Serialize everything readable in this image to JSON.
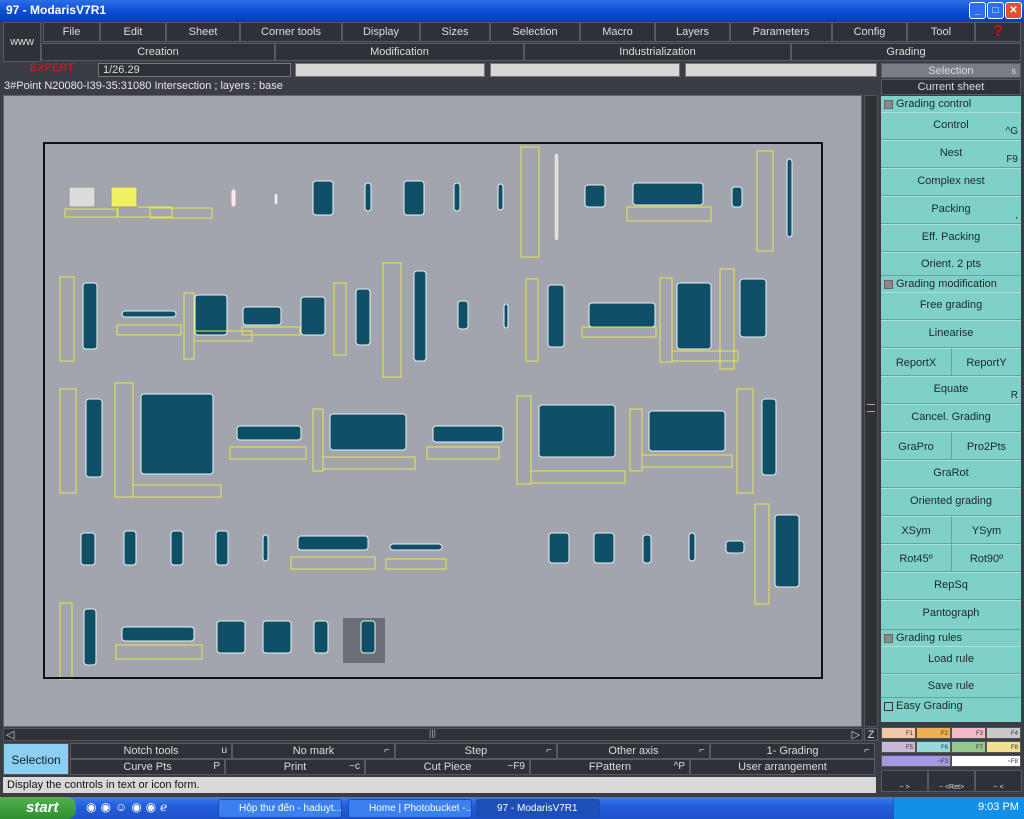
{
  "window": {
    "title": "97   - ModarisV7R1"
  },
  "menu": {
    "www": "www",
    "items": [
      "File",
      "Edit",
      "Sheet",
      "Corner tools",
      "Display",
      "Sizes",
      "Selection",
      "Macro",
      "Layers",
      "Parameters",
      "Config",
      "Tool"
    ],
    "help": "?"
  },
  "groups": [
    "Creation",
    "Modification",
    "Industrialization",
    "Grading"
  ],
  "toolbar": {
    "mode": "EXPERT",
    "scale": "1/26.29",
    "selection": "Selection",
    "selection_key": "s",
    "current_sheet": "Current sheet"
  },
  "info_line": "3#Point N20080-I39-35:31080 Intersection ;    layers :  base",
  "panel": [
    {
      "type": "check",
      "label": "Grading control"
    },
    {
      "type": "btn",
      "label": "Control",
      "key": "^G"
    },
    {
      "type": "btn",
      "label": "Nest",
      "key": "F9"
    },
    {
      "type": "btn",
      "label": "Complex nest"
    },
    {
      "type": "btn",
      "label": "Packing",
      "key": ","
    },
    {
      "type": "btn",
      "label": "Eff. Packing"
    },
    {
      "type": "btn",
      "label": "Orient. 2 pts"
    },
    {
      "type": "check",
      "label": "Grading modification"
    },
    {
      "type": "btn",
      "label": "Free grading"
    },
    {
      "type": "btn",
      "label": "Linearise"
    },
    {
      "type": "pair",
      "labels": [
        "ReportX",
        "ReportY"
      ]
    },
    {
      "type": "btn",
      "label": "Equate",
      "key": "R"
    },
    {
      "type": "btn",
      "label": "Cancel. Grading"
    },
    {
      "type": "pair",
      "labels": [
        "GraPro",
        "Pro2Pts"
      ]
    },
    {
      "type": "btn",
      "label": "GraRot"
    },
    {
      "type": "btn",
      "label": "Oriented grading"
    },
    {
      "type": "pair",
      "labels": [
        "XSym",
        "YSym"
      ]
    },
    {
      "type": "pair",
      "labels": [
        "Rot45º",
        "Rot90º"
      ]
    },
    {
      "type": "btn",
      "label": "RepSq"
    },
    {
      "type": "btn",
      "label": "Pantograph"
    },
    {
      "type": "check",
      "label": "Grading rules"
    },
    {
      "type": "btn",
      "label": "Load rule"
    },
    {
      "type": "btn",
      "label": "Save rule"
    },
    {
      "type": "check",
      "label": "Easy Grading",
      "empty": true
    }
  ],
  "fkeys": [
    {
      "label": "F1",
      "color": "#f2c8a8"
    },
    {
      "label": "F2",
      "color": "#f0b050"
    },
    {
      "label": "F3",
      "color": "#f7b8c8"
    },
    {
      "label": "F4",
      "color": "#c8c8c8"
    },
    {
      "label": "F5",
      "color": "#c8b8d8"
    },
    {
      "label": "F6",
      "color": "#98d8d8"
    },
    {
      "label": "F7",
      "color": "#98c890"
    },
    {
      "label": "F8",
      "color": "#f0e090"
    },
    {
      "label": "~F3",
      "color": "#a898e0"
    },
    {
      "label": "~F8",
      "color": "#ffffff"
    }
  ],
  "nav_keys": [
    "~  >",
    "~ <Ret>",
    "~  <"
  ],
  "bottom": {
    "selection": "Selection",
    "row1": [
      {
        "label": "Notch tools",
        "key": "u"
      },
      {
        "label": "No mark",
        "key": "⌐"
      },
      {
        "label": "Step",
        "key": "⌐"
      },
      {
        "label": "Other axis",
        "key": "⌐"
      },
      {
        "label": "1- Grading",
        "key": "⌐"
      }
    ],
    "row2": [
      {
        "label": "Curve Pts",
        "key": "P"
      },
      {
        "label": "Print",
        "key": "~c"
      },
      {
        "label": "Cut Piece",
        "key": "~F9"
      },
      {
        "label": "FPattern",
        "key": "^P"
      },
      {
        "label": "User arrangement",
        "key": ""
      }
    ],
    "zoom_key": "Z"
  },
  "status": "Display the controls in text or icon form.",
  "taskbar": {
    "start": "start",
    "tasks": [
      "Hộp thư đến - haduyt...",
      "Home | Photobucket -...",
      "97   - ModarisV7R1"
    ],
    "clock": "9:03 PM"
  },
  "colors": {
    "piece": "#0f4f66",
    "label_box": "#e8e84a",
    "panel": "#7fd0c8"
  }
}
